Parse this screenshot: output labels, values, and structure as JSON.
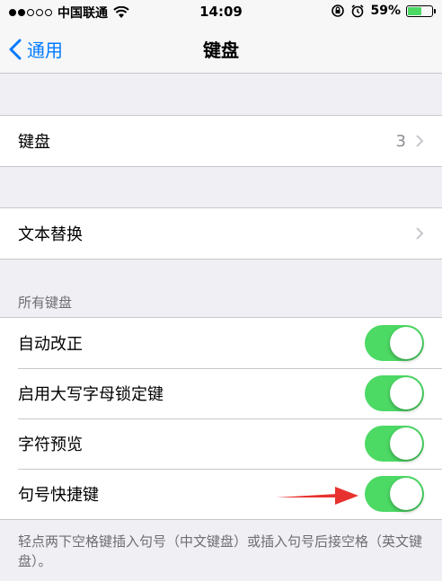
{
  "statusbar": {
    "carrier": "中国联通",
    "time": "14:09",
    "battery": "59%",
    "battery_level": 0.59
  },
  "navbar": {
    "back_label": "通用",
    "title": "键盘"
  },
  "keyboard_row": {
    "label": "键盘",
    "value": "3"
  },
  "text_replace_row": {
    "label": "文本替换"
  },
  "all_keyboards": {
    "header": "所有键盘",
    "items": [
      {
        "label": "自动改正",
        "on": true
      },
      {
        "label": "启用大写字母锁定键",
        "on": true
      },
      {
        "label": "字符预览",
        "on": true
      },
      {
        "label": "句号快捷键",
        "on": true
      }
    ]
  },
  "footer": {
    "text": "轻点两下空格键插入句号（中文键盘）或插入句号后接空格（英文键盘）。"
  },
  "colors": {
    "accent": "#007aff",
    "toggle_on": "#4cd964",
    "arrow": "#e8322f"
  }
}
